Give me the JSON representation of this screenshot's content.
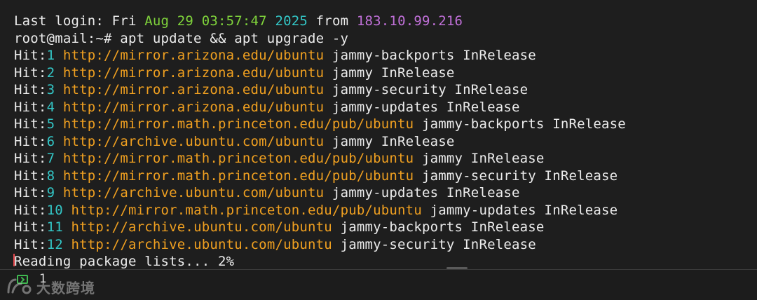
{
  "terminal": {
    "lines": [
      [
        {
          "t": "Last login: Fri ",
          "c": "w"
        },
        {
          "t": "Aug 29 03:57:47",
          "c": "g"
        },
        {
          "t": " ",
          "c": "w"
        },
        {
          "t": "2025",
          "c": "c"
        },
        {
          "t": " from ",
          "c": "w"
        },
        {
          "t": "183.10.99.216",
          "c": "m"
        }
      ],
      [
        {
          "t": "root@mail:~# apt update && apt upgrade -y",
          "c": "w"
        }
      ],
      [
        {
          "t": "Hit:",
          "c": "w"
        },
        {
          "t": "1",
          "c": "c"
        },
        {
          "t": " ",
          "c": "w"
        },
        {
          "t": "http://mirror.arizona.edu/ubuntu",
          "c": "o"
        },
        {
          "t": " jammy-backports InRelease",
          "c": "w"
        }
      ],
      [
        {
          "t": "Hit:",
          "c": "w"
        },
        {
          "t": "2",
          "c": "c"
        },
        {
          "t": " ",
          "c": "w"
        },
        {
          "t": "http://mirror.arizona.edu/ubuntu",
          "c": "o"
        },
        {
          "t": " jammy InRelease",
          "c": "w"
        }
      ],
      [
        {
          "t": "Hit:",
          "c": "w"
        },
        {
          "t": "3",
          "c": "c"
        },
        {
          "t": " ",
          "c": "w"
        },
        {
          "t": "http://mirror.arizona.edu/ubuntu",
          "c": "o"
        },
        {
          "t": " jammy-security InRelease",
          "c": "w"
        }
      ],
      [
        {
          "t": "Hit:",
          "c": "w"
        },
        {
          "t": "4",
          "c": "c"
        },
        {
          "t": " ",
          "c": "w"
        },
        {
          "t": "http://mirror.arizona.edu/ubuntu",
          "c": "o"
        },
        {
          "t": " jammy-updates InRelease",
          "c": "w"
        }
      ],
      [
        {
          "t": "Hit:",
          "c": "w"
        },
        {
          "t": "5",
          "c": "c"
        },
        {
          "t": " ",
          "c": "w"
        },
        {
          "t": "http://mirror.math.princeton.edu/pub/ubuntu",
          "c": "o"
        },
        {
          "t": " jammy-backports InRelease",
          "c": "w"
        }
      ],
      [
        {
          "t": "Hit:",
          "c": "w"
        },
        {
          "t": "6",
          "c": "c"
        },
        {
          "t": " ",
          "c": "w"
        },
        {
          "t": "http://archive.ubuntu.com/ubuntu",
          "c": "o"
        },
        {
          "t": " jammy InRelease",
          "c": "w"
        }
      ],
      [
        {
          "t": "Hit:",
          "c": "w"
        },
        {
          "t": "7",
          "c": "c"
        },
        {
          "t": " ",
          "c": "w"
        },
        {
          "t": "http://mirror.math.princeton.edu/pub/ubuntu",
          "c": "o"
        },
        {
          "t": " jammy InRelease",
          "c": "w"
        }
      ],
      [
        {
          "t": "Hit:",
          "c": "w"
        },
        {
          "t": "8",
          "c": "c"
        },
        {
          "t": " ",
          "c": "w"
        },
        {
          "t": "http://mirror.math.princeton.edu/pub/ubuntu",
          "c": "o"
        },
        {
          "t": " jammy-security InRelease",
          "c": "w"
        }
      ],
      [
        {
          "t": "Hit:",
          "c": "w"
        },
        {
          "t": "9",
          "c": "c"
        },
        {
          "t": " ",
          "c": "w"
        },
        {
          "t": "http://archive.ubuntu.com/ubuntu",
          "c": "o"
        },
        {
          "t": " jammy-updates InRelease",
          "c": "w"
        }
      ],
      [
        {
          "t": "Hit:",
          "c": "w"
        },
        {
          "t": "10",
          "c": "c"
        },
        {
          "t": " ",
          "c": "w"
        },
        {
          "t": "http://mirror.math.princeton.edu/pub/ubuntu",
          "c": "o"
        },
        {
          "t": " jammy-updates InRelease",
          "c": "w"
        }
      ],
      [
        {
          "t": "Hit:",
          "c": "w"
        },
        {
          "t": "11",
          "c": "c"
        },
        {
          "t": " ",
          "c": "w"
        },
        {
          "t": "http://archive.ubuntu.com/ubuntu",
          "c": "o"
        },
        {
          "t": " jammy-backports InRelease",
          "c": "w"
        }
      ],
      [
        {
          "t": "Hit:",
          "c": "w"
        },
        {
          "t": "12",
          "c": "c"
        },
        {
          "t": " ",
          "c": "w"
        },
        {
          "t": "http://archive.ubuntu.com/ubuntu",
          "c": "o"
        },
        {
          "t": " jammy-security InRelease",
          "c": "w"
        }
      ],
      [
        {
          "t": "Reading package lists... 2%",
          "c": "w"
        }
      ]
    ]
  },
  "colors": {
    "background": "#1e1e1e",
    "text": "#ececec",
    "date_green": "#7fd33b",
    "number_cyan": "#33c6c6",
    "ip_magenta": "#c070d8",
    "url_orange": "#f0a020",
    "cursor_red": "#e5484d",
    "status_icon_green": "#3fb950"
  },
  "statusbar": {
    "icon": "terminal-icon",
    "session_count": "1"
  },
  "watermark": {
    "text": "大数跨境",
    "logo": "watermark-logo"
  }
}
